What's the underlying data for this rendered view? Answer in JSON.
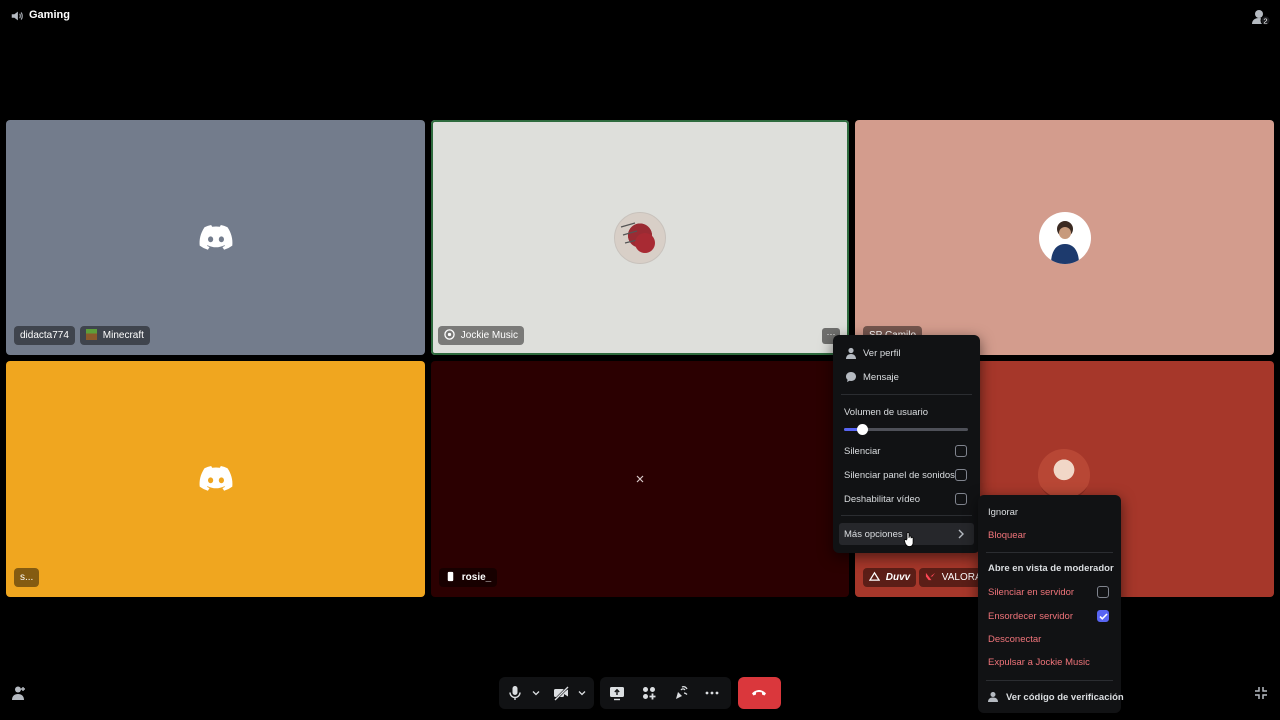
{
  "top": {
    "channel": "Gaming",
    "people_count": "2"
  },
  "tiles": [
    {
      "name": "didacta774",
      "activity": "Minecraft",
      "bg": "#737c8c"
    },
    {
      "name": "Jockie Music",
      "bg": "#dedfdb"
    },
    {
      "name": "SP Camilo",
      "bg": "#d39c8d"
    },
    {
      "name": "s...",
      "bg": "#f0a61f"
    },
    {
      "name": "rosie_",
      "bg": "#2b0001"
    },
    {
      "name": "Duvv",
      "activity": "VALORANT",
      "bg": "#a6372a"
    }
  ],
  "context_menu": {
    "view_profile": "Ver perfil",
    "message": "Mensaje",
    "volume_label": "Volumen de usuario",
    "volume_level": 0.15,
    "mute": "Silenciar",
    "mute_soundboard": "Silenciar panel de sonidos",
    "disable_video": "Deshabilitar vídeo",
    "more_options": "Más opciones"
  },
  "submenu": {
    "ignore": "Ignorar",
    "block": "Bloquear",
    "moderator_header": "Abre en vista de moderador",
    "server_mute": "Silenciar en servidor",
    "server_mute_checked": false,
    "server_deafen": "Ensordecer servidor",
    "server_deafen_checked": true,
    "disconnect": "Desconectar",
    "kick": "Expulsar a Jockie Music",
    "verify_code": "Ver código de verificación"
  },
  "colors": {
    "accent": "#5865f2",
    "danger": "#da373c",
    "danger_text": "#f0747a"
  }
}
